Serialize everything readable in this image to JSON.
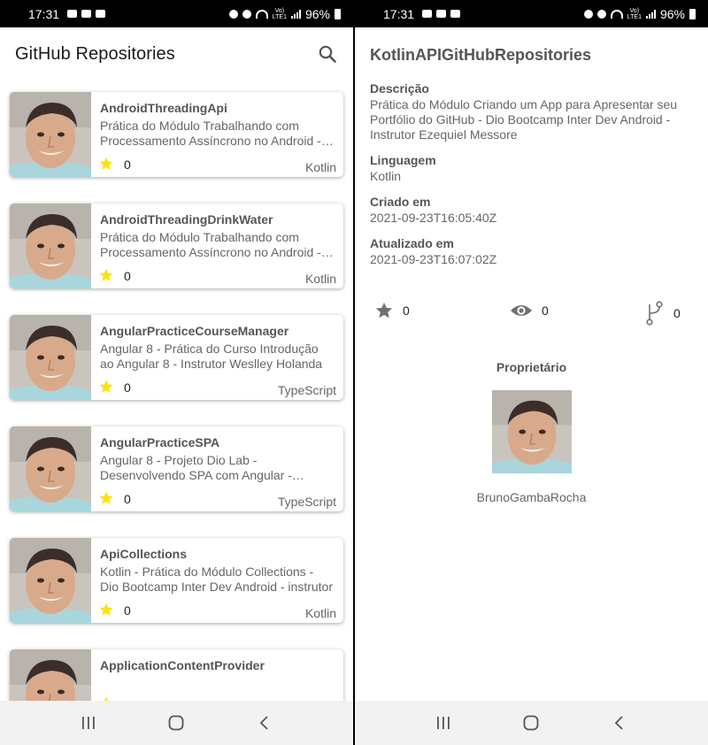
{
  "status_bar": {
    "time": "17:31",
    "network": "Vo)\nLTE1",
    "battery": "96%"
  },
  "list_screen": {
    "title": "GitHub Repositories",
    "repos": [
      {
        "name": "AndroidThreadingApi",
        "description": "Prática do Módulo Trabalhando com Processamento Assíncrono no Android - Dio Bootcamp Inter Dev Android",
        "stars": "0",
        "language": "Kotlin"
      },
      {
        "name": "AndroidThreadingDrinkWater",
        "description": "Prática do Módulo Trabalhando com Processamento Assíncrono no Android - Dio Bootcamp Inter Dev Android",
        "stars": "0",
        "language": "Kotlin"
      },
      {
        "name": "AngularPracticeCourseManager",
        "description": "Angular 8 - Prática do Curso Introdução ao Angular 8 - Instrutor Weslley Holanda",
        "stars": "0",
        "language": "TypeScript"
      },
      {
        "name": "AngularPracticeSPA",
        "description": "Angular 8 - Projeto Dio Lab - Desenvolvendo SPA com Angular - Instrutor",
        "stars": "0",
        "language": "TypeScript"
      },
      {
        "name": "ApiCollections",
        "description": "Kotlin - Prática do Módulo Collections - Dio Bootcamp Inter Dev Android - instrutor",
        "stars": "0",
        "language": "Kotlin"
      },
      {
        "name": "ApplicationContentProvider",
        "description": "",
        "stars": "",
        "language": ""
      }
    ]
  },
  "detail_screen": {
    "title": "KotlinAPIGitHubRepositories",
    "description_label": "Descrição",
    "description": "Prática do Módulo Criando um App para Apresentar seu Portfólio do GitHub - Dio Bootcamp Inter Dev Android - Instrutor Ezequiel Messore",
    "language_label": "Linguagem",
    "language": "Kotlin",
    "created_label": "Criado em",
    "created": "2021-09-23T16:05:40Z",
    "updated_label": "Atualizado em",
    "updated": "2021-09-23T16:07:02Z",
    "stars": "0",
    "watchers": "0",
    "forks": "0",
    "owner_label": "Proprietário",
    "owner_name": "BrunoGambaRocha"
  },
  "colors": {
    "star": "#fde20a",
    "stat_icon": "#707070",
    "card_shadow": "#999999",
    "navbar": "#f2f2f2"
  },
  "icons": [
    "search-icon",
    "star-icon",
    "eye-icon",
    "fork-icon",
    "recent-apps-icon",
    "home-icon",
    "back-icon"
  ]
}
